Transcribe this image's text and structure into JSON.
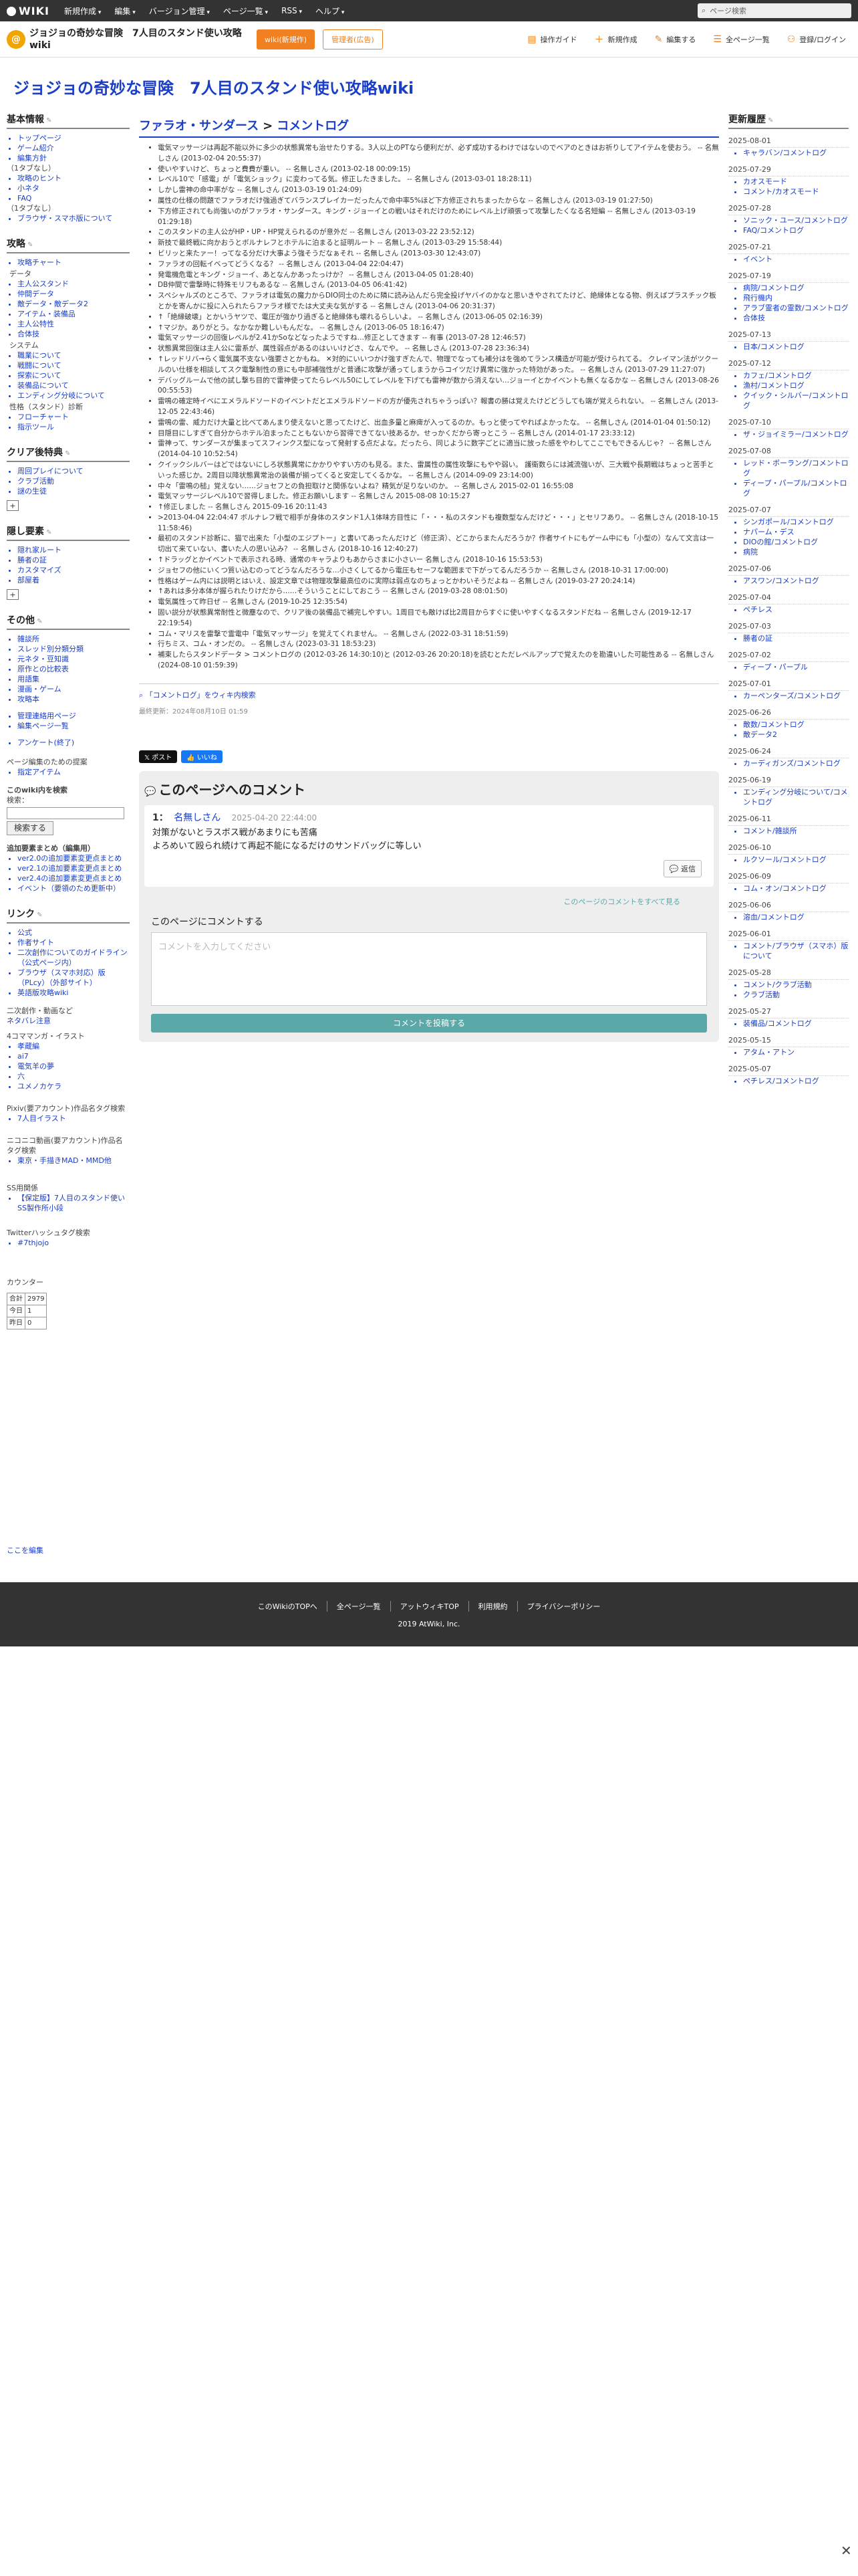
{
  "gbar": {
    "logo": "WIKI",
    "menus": [
      "新規作成",
      "編集",
      "バージョン管理",
      "ページ一覧",
      "RSS",
      "ヘルプ"
    ],
    "search_placeholder": "ページ検索"
  },
  "site": {
    "title": "ジョジョの奇妙な冒険　7人目のスタンド使い攻略wiki",
    "btn_wiki": "wiki(新規作)",
    "btn_ad": "管理者(広告)",
    "tools": [
      {
        "icon": "book-icon",
        "label": "操作ガイド"
      },
      {
        "icon": "plus-icon",
        "label": "新規作成"
      },
      {
        "icon": "pencil-icon",
        "label": "編集する"
      },
      {
        "icon": "list-icon",
        "label": "全ページ一覧"
      },
      {
        "icon": "users-icon",
        "label": "登録/ログイン"
      }
    ]
  },
  "page_title": "ジョジョの奇妙な冒険　7人目のスタンド使い攻略wiki",
  "left": {
    "basic": {
      "title": "基本情報",
      "items": [
        "トップページ",
        "ゲーム紹介",
        "編集方針"
      ],
      "note": "（1タブなし）",
      "items2": [
        "攻略のヒント",
        "小ネタ",
        "FAQ"
      ],
      "note2": "（1タブなし）",
      "items3": [
        "ブラウザ・スマホ版について"
      ]
    },
    "capture": {
      "title": "攻略",
      "items": [
        "攻略チャート"
      ],
      "sec_data": "データ",
      "data_items": [
        "主人公スタンド",
        "仲間データ",
        "敵データ・敵データ2",
        "アイテム・装備品",
        "主人公特性",
        "合体技"
      ],
      "sec_sys": "システム",
      "sys_items": [
        "職業について",
        "戦闘について",
        "探索について",
        "装備品について",
        "エンディング分岐について"
      ],
      "sec_char": "性格（スタンド）診断",
      "char_items": [
        "フローチャート",
        "指示ツール"
      ]
    },
    "clear": {
      "title": "クリア後特典",
      "items": [
        "周回プレイについて",
        "クラブ活動",
        "謎の生徒"
      ],
      "plus": "+"
    },
    "hidden": {
      "title": "隠し要素",
      "items": [
        "隠れ家ルート",
        "勝者の証",
        "カスタマイズ",
        "部屋着"
      ],
      "plus": "+"
    },
    "other": {
      "title": "その他",
      "items": [
        "雑談所",
        "スレッド別分類分類",
        "元ネタ・豆知識",
        "原作との比較表",
        "用語集",
        "漫画・ゲーム",
        "攻略本"
      ],
      "items2": [
        "管理連絡用ページ",
        "編集ページ一覧"
      ],
      "items3": [
        "アンケート(終了)"
      ]
    },
    "editor": {
      "label": "ページ編集のための提案",
      "items": [
        "指定アイテム"
      ]
    },
    "search": {
      "label": "このwiki内を検索",
      "sub": "検索：",
      "button": "検索する"
    },
    "recent_title": "追加要素まとめ（編集用）",
    "recent_items": [
      "ver2.0の追加要素変更点まとめ",
      "ver2.1の追加要素変更点まとめ",
      "ver2.4の追加要素変更点まとめ",
      "イベント（要領のため更新中）"
    ],
    "links": {
      "title": "リンク",
      "items": [
        "公式",
        "作者サイト",
        "二次創作についてのガイドライン（公式ページ内）",
        "ブラウザ（スマホ対応）版（PLcy）（外部サイト）",
        "英語版攻略wiki"
      ]
    },
    "fanart": {
      "label": "二次創作・動画など",
      "link": "ネタバレ注意",
      "label2": "4コママンガ・イラスト",
      "items": [
        "孝蔵編",
        "ai7",
        "電気羊の夢",
        "六",
        "ユメノカケラ"
      ]
    },
    "pixiv": {
      "label": "Pixiv(要アカウント)作品名タグ検索",
      "items": [
        "7人目イラスト"
      ]
    },
    "nico": {
      "label": "ニコニコ動画(要アカウント)作品名タグ検索",
      "items": [
        "東京・手描きMAD・MMD他"
      ]
    },
    "ss": {
      "label": "SS用関係",
      "items": [
        "【保定版】7人目のスタンド使いSS製作所小段"
      ]
    },
    "twitter": {
      "label": "Twitterハッシュタグ検索",
      "items": [
        "#7thjojo"
      ]
    },
    "counter": {
      "label": "カウンター",
      "rows": [
        [
          "合計",
          "2979"
        ],
        [
          "今日",
          "1"
        ],
        [
          "昨日",
          "0"
        ]
      ]
    }
  },
  "main": {
    "crumb_parent": "ファラオ・サンダース",
    "crumb_sep": ">",
    "crumb_current": "コメントログ",
    "comments": [
      "電気マッサージは再起不能以外に多少の状態異常も治せたりする。3人以上のPTなら便利だが、必ず成功するわけではないのでベアのときはお祈りしてアイテムを使おう。 -- 名無しさん (2013-02-04 20:55:37)",
      "使いやすいけど、ちょっと費費が重い。 -- 名無しさん (2013-02-18 00:09:15)",
      "レベル10で「感電」が「電気ショック」に変わってる気。修正したきました。 -- 名無しさん (2013-03-01 18:28:11)",
      "しかし雷神の命中率がな -- 名無しさん (2013-03-19 01:24:09)",
      "属性の仕様の問題でファラオだけ強過ぎてバランスブレイカーだったんで命中率5%ほど下方修正されちまったからな -- 名無しさん (2013-03-19 01:27:50)",
      "下方修正されても尚強いのがファラオ・サンダース。キング・ジョーイとの戦いはそれだけのためにレベル上げ頑張って攻撃したくなる名短編 -- 名無しさん (2013-03-19 01:29:18)",
      "このスタンドの主人公がHP・UP・HP覚えられるのが意外だ -- 名無しさん (2013-03-22 23:52:12)",
      "新技で最終戦に向かおうとボルナレフとホテルに泊まると証明ルート -- 名無しさん (2013-03-29 15:58:44)",
      "ビリッと来たァー！ってなる分だけ大事よう強そうだなぁそれ -- 名無しさん (2013-03-30 12:43:07)",
      "ファラオの回転イベってどうくなる？ -- 名無しさん (2013-04-04 22:04:47)",
      "発電機危電とキング・ジョーイ、あとなんかあったっけか？ -- 名無しさん (2013-04-05 01:28:40)",
      "DB仲間で雷撃時に特殊モリフもあるな -- 名無しさん (2013-04-05 06:41:42)",
      "スペシャルズのところで、ファラオは電気の魔力からDIO同士のために隣に読み込んだら完全投げヤバイのかなと思いきやされてたけど、絶縁体となる物、例えばプラスチック板とかを寄んかに投に入られたらファラオ様でたは大丈夫な気がする -- 名無しさん (2013-04-06 20:31:37)",
      "↑「絶縁破壊」とかいうヤツで、電圧が強かり過ぎると絶縁体も壊れるらしいよ。 -- 名無しさん (2013-06-05 02:16:39)",
      "↑マジか。ありがとう。なかなか難しいもんだな。 -- 名無しさん (2013-06-05 18:16:47)",
      "電気マッサージの回復レベルが2.41かSoなどなったようですね…修正としてきます -- 有事 (2013-07-28 12:46:57)",
      "状態異常回復は主人公に雷系が、属性弱点があるのはいいけどさ、なんでや。 -- 名無しさん (2013-07-28 23:36:34)",
      "↑レッドリバ→らく電気属不支ない強要さとかもね。 ✕対的にいいつかけ強すぎたんで、物理でなっても補分はを強めてランス構造が可能が受けられてる。 クレイマン法がツクールのい仕様を相談してスク電撃制性の意にも中部補強性がと普通に攻撃が通ってしまうからコイツだけ異常に強かった特効があった。 -- 名無しさん (2013-07-29 11:27:07)",
      "デバッグルームで他の試し撃ち目的で雷神使ってたらレベル50にしてレベルを下げても雷神が数から消えない…ジョーイとかイベントも無くなるかな -- 名無しさん (2013-08-26 00:55:53)",
      "雷鳴の確定時イベにエメラルドソードのイベントだとエメラルドソードの方が優先されちゃうっぽい？報書の勝は覚えたけどどうしても端が覚えられない。 -- 名無しさん (2013-12-05 22:43:46)",
      "雷鳴の雷、威力だけ大量と比べてあんまり使えないと思ってたけど、出血多量と麻痺が入ってるのか。もっと使ってやればよかったな。 -- 名無しさん (2014-01-04 01:50:12)",
      "目隠目にしすぎて自分からホテル泊まったこともないから習得できてない技あるか。せっかくだから寄っとこう -- 名無しさん (2014-01-17 23:33:12)",
      "雷神って、サンダースが集まってスフィンクス型になって発射する点だよな。だったら、同じように数字ごとに適当に放った感をやわしてここでもできるんじゃ？ -- 名無しさん (2014-04-10 10:52:54)",
      "クイックシルバーはどではないにしろ状態異常にかかりやすい方のも見る。また、雷属性の属性攻撃にもやや弱い。 護衛数らには減流強いが、三大戦や長期戦はちょっと苦手といった感じか。2周目以降状態異常治の装備が揃ってくると安定してくるかな。 -- 名無しさん (2014-09-09 23:14:00)",
      "中々「雷鳴の槌」覚えない……ジョセフとの負担取けと関係ないよね？精気が足りないのか。 -- 名無しさん 2015-02-01 16:55:08",
      "電気マッサージレベル10で習得しました。修正お願いします -- 名無しさん 2015-08-08 10:15:27",
      "↑修正しました -- 名無しさん 2015-09-16 20:11:43",
      ">2013-04-04 22:04:47 ボルナレフ戦で相手が身体のスタンド1人1体味方目性に「・・・私のスタンドも複数型なんだけど・・・」とセリフあり。 -- 名無しさん (2018-10-15 11:58:46)",
      "最初のスタンド診断に、猫で出来た「小型のエジプトー」と書いてあったんだけど（修正済）、どこからまたんだろうか？作者サイトにもゲーム中にも「小型の）なんて文言は一切出て来ていない、書いた人の思い込み？ -- 名無しさん (2018-10-16 12:40:27)",
      "↑ドラッグとかイベントで表示される時、通常のキャラよりもあからさまに小さいー 名無しさん (2018-10-16 15:53:53)",
      "ジョセフの他にいくつ質い込むのってどうなんだろうな…小さくしてるから電圧もセーフな範囲まで下がってるんだろうか -- 名無しさん (2018-10-31 17:00:00)",
      "性格はゲーム内には説明とはいえ、設定文章では物理攻撃最高位のに実際は弱点なのちょっとかわいそうだよね -- 名無しさん (2019-03-27 20:24:14)",
      "↑あれは多分本体が握られたりけだから……そういうことにしておこう -- 名無しさん (2019-03-28 08:01:50)",
      "電気属性って昨日ぜ -- 名無しさん (2019-10-25 12:35:54)",
      "固い説分が状態異常耐性と微塵なので、クリア後の装備品で補完しやすい。1周目でも敵けば比2周目からすぐに使いやすくなるスタンドだね -- 名無しさん (2019-12-17 22:19:54)",
      "コム・マリスを雷撃で霊電中「電気マッサージ」を覚えてくれません。 -- 名無しさん (2022-03-31 18:51:59)",
      "行ちミス、コム・オンだの。 -- 名無しさん (2023-03-31 18:53:23)",
      "補束したらスタンドデータ > コメントログの (2012-03-26 14:30:10)と (2012-03-26 20:20:18)を読むとただレベルアップで覚えたのを勘違いした可能性ある -- 名無しさん (2024-08-10 01:59:39)"
    ],
    "wiki_link": "「コメントログ」をウィキ内検索",
    "updated": "最終更新：2024年08月10日 01:59",
    "share_x": "ポスト",
    "share_f": "いいね",
    "comment_box": {
      "title": "このページへのコメント",
      "num": "1：",
      "name": "名無しさん",
      "date": "2025-04-20 22:44:00",
      "text1": "対策がないとラスボス戦があまりにも苦痛",
      "text2": "よろめいて殴られ続けて再起不能になるだけのサンドバッグに等しい",
      "reply": "返信",
      "see_all": "このページのコメントをすべて見る",
      "form_label": "このページにコメントする",
      "placeholder": "コメントを入力してください",
      "submit": "コメントを投稿する"
    }
  },
  "right": {
    "title": "更新履歴",
    "groups": [
      {
        "date": "2025-08-01",
        "items": [
          "キャラバン/コメントログ"
        ]
      },
      {
        "date": "2025-07-29",
        "items": [
          "カオスモード",
          "コメント/カオスモード"
        ]
      },
      {
        "date": "2025-07-28",
        "items": [
          "ソニック・ユース/コメントログ",
          "FAQ/コメントログ"
        ]
      },
      {
        "date": "2025-07-21",
        "items": [
          "イベント"
        ]
      },
      {
        "date": "2025-07-19",
        "items": [
          "病院/コメントログ",
          "飛行機内",
          "アラブ霊者の霊数/コメントログ",
          "合体技"
        ]
      },
      {
        "date": "2025-07-13",
        "items": [
          "日本/コメントログ"
        ]
      },
      {
        "date": "2025-07-12",
        "items": [
          "カフェ/コメントログ",
          "漁村/コメントログ",
          "クイック・シルバー/コメントログ"
        ]
      },
      {
        "date": "2025-07-10",
        "items": [
          "ザ・ジョイミラー/コメントログ"
        ]
      },
      {
        "date": "2025-07-08",
        "items": [
          "レッド・ボーラング/コメントログ",
          "ディープ・パープル/コメントログ"
        ]
      },
      {
        "date": "2025-07-07",
        "items": [
          "シンガポール/コメントログ",
          "ナパーム・デス",
          "DIOの館/コメントログ",
          "病院"
        ]
      },
      {
        "date": "2025-07-06",
        "items": [
          "アスワン/コメントログ"
        ]
      },
      {
        "date": "2025-07-04",
        "items": [
          "ペチレス"
        ]
      },
      {
        "date": "2025-07-03",
        "items": [
          "勝者の証"
        ]
      },
      {
        "date": "2025-07-02",
        "items": [
          "ディープ・パープル"
        ]
      },
      {
        "date": "2025-07-01",
        "items": [
          "カーペンターズ/コメントログ"
        ]
      },
      {
        "date": "2025-06-26",
        "items": [
          "敵数/コメントログ",
          "敵データ2"
        ]
      },
      {
        "date": "2025-06-24",
        "items": [
          "カーディガンズ/コメントログ"
        ]
      },
      {
        "date": "2025-06-19",
        "items": [
          "エンディング分岐について/コメントログ"
        ]
      },
      {
        "date": "2025-06-11",
        "items": [
          "コメント/雑談所"
        ]
      },
      {
        "date": "2025-06-10",
        "items": [
          "ルクソール/コメントログ"
        ]
      },
      {
        "date": "2025-06-09",
        "items": [
          "コム・オン/コメントログ"
        ]
      },
      {
        "date": "2025-06-06",
        "items": [
          "溶血/コメントログ"
        ]
      },
      {
        "date": "2025-06-01",
        "items": [
          "コメント/ブラウザ（スマホ）版について"
        ]
      },
      {
        "date": "2025-05-28",
        "items": [
          "コメント/クラブ活動",
          "クラブ活動"
        ]
      },
      {
        "date": "2025-05-27",
        "items": [
          "装備品/コメントログ"
        ]
      },
      {
        "date": "2025-05-15",
        "items": [
          "アタム・アトン"
        ]
      },
      {
        "date": "2025-05-07",
        "items": [
          "ペチレス/コメントログ"
        ]
      }
    ]
  },
  "edit_label": "ここを編集",
  "footer": {
    "links": [
      "このWikiのTOPへ",
      "全ページ一覧",
      "アットウィキTOP",
      "利用規約",
      "プライバシーポリシー"
    ],
    "copy": "2019 AtWiki, Inc."
  },
  "close": "✕"
}
